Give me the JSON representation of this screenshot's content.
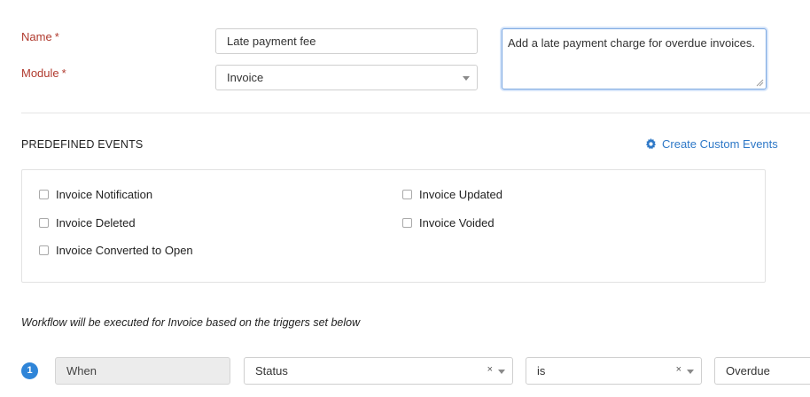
{
  "form": {
    "name_label": "Name",
    "module_label": "Module",
    "required_marker": "*",
    "name_value": "Late payment fee",
    "module_value": "Invoice",
    "description_value": "Add a late payment charge for overdue invoices."
  },
  "events": {
    "title": "PREDEFINED EVENTS",
    "custom_link": "Create Custom Events",
    "items": [
      {
        "label": "Invoice Notification",
        "checked": false
      },
      {
        "label": "Invoice Updated",
        "checked": false
      },
      {
        "label": "Invoice Deleted",
        "checked": false
      },
      {
        "label": "Invoice Voided",
        "checked": false
      },
      {
        "label": "Invoice Converted to Open",
        "checked": false
      }
    ]
  },
  "workflow": {
    "note": "Workflow will be executed for Invoice based on the triggers set below",
    "trigger": {
      "step": "1",
      "when": "When",
      "field": "Status",
      "operator": "is",
      "value": "Overdue",
      "clear_symbol": "×"
    }
  },
  "icons": {
    "gear": "gear-icon",
    "caret": "chevron-down-icon",
    "resize": "resize-grip-icon"
  },
  "colors": {
    "required_label": "#b03a2e",
    "link": "#2e78c7",
    "step_badge": "#2f85d8",
    "focus_border": "#7aa7e0"
  }
}
